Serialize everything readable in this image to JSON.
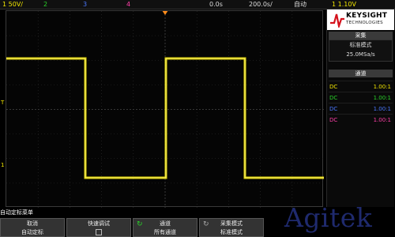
{
  "status_bar": {
    "ch1": "1  50V/",
    "ch2": "2",
    "ch3": "3",
    "ch4": "4",
    "time_pos": "0.0s",
    "time_scale": "200.0s/",
    "trigger_mode": "自动",
    "trigger_level": "1  1.10V",
    "colors": {
      "ch1": "#f2e600",
      "ch2": "#29d329",
      "ch3": "#4a78ff",
      "ch4": "#ff3fa8"
    }
  },
  "panel": {
    "brand": "KEYSIGHT",
    "brand_sub": "TECHNOLOGIES",
    "acq_title": "采集",
    "acq_mode": "标准模式",
    "acq_rate": "25.0MSa/s",
    "channel_title": "通道",
    "channels": [
      {
        "coupling": "DC",
        "probe": "1.00:1",
        "color": "#f2e600"
      },
      {
        "coupling": "DC",
        "probe": "1.00:1",
        "color": "#29d329"
      },
      {
        "coupling": "DC",
        "probe": "1.00:1",
        "color": "#4a78ff"
      },
      {
        "coupling": "DC",
        "probe": "1.00:1",
        "color": "#ff3fa8"
      }
    ]
  },
  "markers": {
    "trigger": "T",
    "ground": "1"
  },
  "menu": {
    "title": "自动定标菜单",
    "keys": [
      {
        "l1": "取消",
        "l2": "自动定标"
      },
      {
        "l1": "快速调试",
        "l2": ""
      },
      {
        "l1": "通道",
        "l2": "所有通道"
      },
      {
        "l1": "采集模式",
        "l2": "标准模式"
      }
    ]
  },
  "watermark": "Agitek"
}
